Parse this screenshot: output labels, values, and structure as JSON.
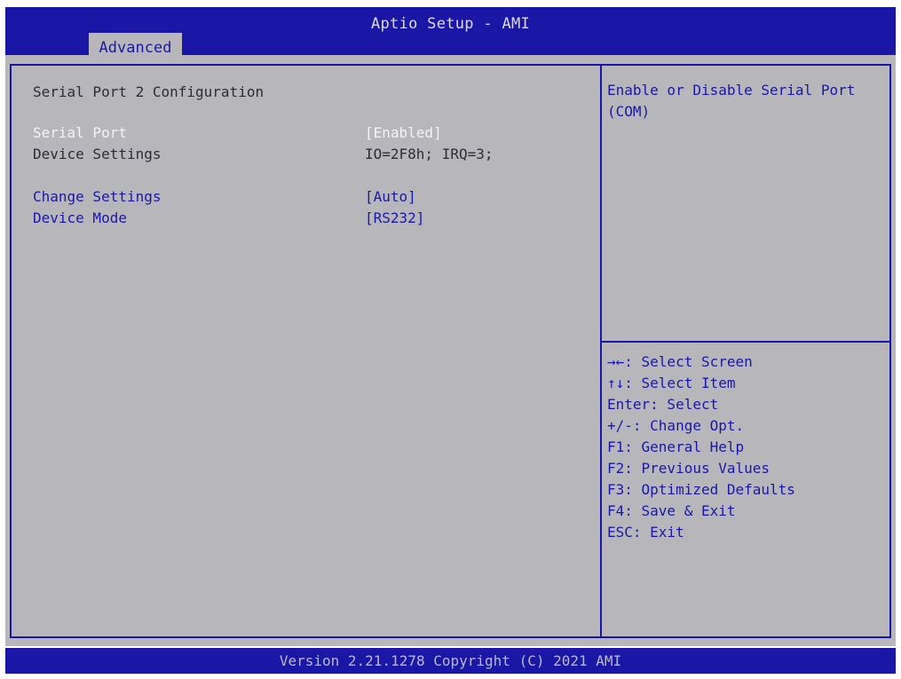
{
  "window": {
    "title": "Aptio Setup - AMI"
  },
  "tabs": [
    {
      "label": "Advanced",
      "active": true
    }
  ],
  "main": {
    "section_title": "Serial Port 2 Configuration",
    "items": [
      {
        "label": "Serial Port",
        "value": "[Enabled]",
        "selected": true
      },
      {
        "label": "Device Settings",
        "value": "IO=2F8h; IRQ=3;",
        "selected": false
      },
      {
        "label": "Change Settings",
        "value": "[Auto]",
        "selected": false
      },
      {
        "label": "Device Mode",
        "value": "[RS232]",
        "selected": false
      }
    ]
  },
  "help": {
    "description": "Enable or Disable Serial Port\n(COM)",
    "keys": [
      {
        "text": "→←: Select Screen"
      },
      {
        "text": "↑↓: Select Item"
      },
      {
        "text": "Enter: Select"
      },
      {
        "text": "+/-: Change Opt."
      },
      {
        "text": "F1: General Help"
      },
      {
        "text": "F2: Previous Values"
      },
      {
        "text": "F3: Optimized Defaults"
      },
      {
        "text": "F4: Save & Exit"
      },
      {
        "text": "ESC: Exit"
      }
    ]
  },
  "footer": {
    "version": "Version 2.21.1278 Copyright (C) 2021 AMI"
  },
  "colors": {
    "bar_blue": "#1b17a6",
    "panel_gray": "#b7b7bb",
    "highlight_white": "#f4f4f8",
    "text_dark": "#2c2c34"
  }
}
